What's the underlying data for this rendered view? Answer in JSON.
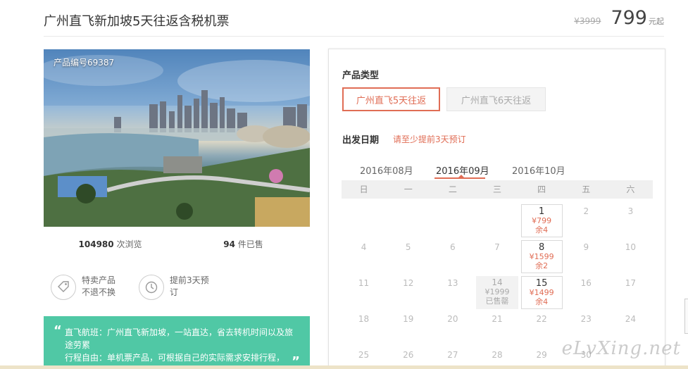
{
  "header": {
    "title": "广州直飞新加坡5天往返含税机票",
    "original_price": "¥3999",
    "price": "799",
    "price_suffix": "元起"
  },
  "photo": {
    "product_code": "产品编号69387"
  },
  "stats": {
    "views": "104980",
    "views_label": "次浏览",
    "sold": "94",
    "sold_label": "件已售"
  },
  "features": [
    {
      "icon": "tag-icon",
      "lines": [
        "特卖产品",
        "不退不换"
      ]
    },
    {
      "icon": "clock-icon",
      "text": "提前3天预订"
    }
  ],
  "highlight": {
    "lines": [
      "直飞航班：广州直飞新加坡，一站直达，省去转机时间以及旅途劳累",
      "行程自由：单机票产品，可根据自己的实际需求安排行程，"
    ]
  },
  "booking": {
    "product_type_label": "产品类型",
    "options": [
      "广州直飞5天往返",
      "广州直飞6天往返"
    ],
    "date_label": "出发日期",
    "date_note": "请至少提前3天预订",
    "months": [
      "2016年08月",
      "2016年09月",
      "2016年10月"
    ],
    "weekdays": [
      "日",
      "一",
      "二",
      "三",
      "四",
      "五",
      "六"
    ],
    "calendar": [
      [
        {
          "d": ""
        },
        {
          "d": ""
        },
        {
          "d": ""
        },
        {
          "d": ""
        },
        {
          "d": "1",
          "p": "¥799",
          "r": "余4",
          "s": "avail"
        },
        {
          "d": "2"
        },
        {
          "d": "3"
        }
      ],
      [
        {
          "d": "4"
        },
        {
          "d": "5"
        },
        {
          "d": "6"
        },
        {
          "d": "7"
        },
        {
          "d": "8",
          "p": "¥1599",
          "r": "余2",
          "s": "avail"
        },
        {
          "d": "9"
        },
        {
          "d": "10"
        }
      ],
      [
        {
          "d": "11"
        },
        {
          "d": "12"
        },
        {
          "d": "13"
        },
        {
          "d": "14",
          "p": "¥1999",
          "r": "已售罄",
          "s": "sold"
        },
        {
          "d": "15",
          "p": "¥1499",
          "r": "余4",
          "s": "avail"
        },
        {
          "d": "16"
        },
        {
          "d": "17"
        }
      ],
      [
        {
          "d": "18"
        },
        {
          "d": "19"
        },
        {
          "d": "20"
        },
        {
          "d": "21"
        },
        {
          "d": "22"
        },
        {
          "d": "23"
        },
        {
          "d": "24"
        }
      ],
      [
        {
          "d": "25"
        },
        {
          "d": "26"
        },
        {
          "d": "27"
        },
        {
          "d": "28"
        },
        {
          "d": "29"
        },
        {
          "d": "30"
        },
        {
          "d": ""
        }
      ]
    ]
  },
  "watermark": "eLvXing.net",
  "colors": {
    "accent": "#e06d55",
    "green": "#50c8a5"
  }
}
